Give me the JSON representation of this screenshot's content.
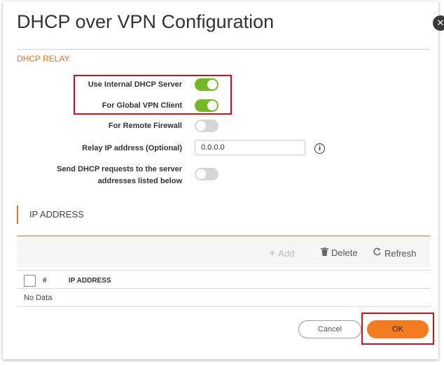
{
  "dialog": {
    "title": "DHCP over VPN Configuration",
    "close_glyph": "✕"
  },
  "dhcp_relay": {
    "section_label": "DHCP RELAY",
    "use_internal_label": "Use Internal DHCP Server",
    "use_internal_on": true,
    "global_vpn_label": "For Global VPN Client",
    "global_vpn_on": true,
    "remote_fw_label": "For Remote Firewall",
    "remote_fw_on": false,
    "relay_ip_label": "Relay IP address (Optional)",
    "relay_ip_value": "0.0.0.0",
    "send_requests_label_line1": "Send DHCP requests to the server",
    "send_requests_label_line2": "addresses listed below",
    "send_requests_on": false,
    "info_glyph": "i"
  },
  "ip_table": {
    "section_title": "IP ADDRESS",
    "add_label": "Add",
    "delete_label": "Delete",
    "refresh_label": "Refresh",
    "col_num": "#",
    "col_ip": "IP ADDRESS",
    "empty_text": "No Data"
  },
  "footer": {
    "cancel_label": "Cancel",
    "ok_label": "OK"
  },
  "colors": {
    "accent": "#f26f21",
    "toggle_on": "#74b728",
    "toggle_off": "#d6d6d6",
    "highlight": "#d0101a"
  }
}
